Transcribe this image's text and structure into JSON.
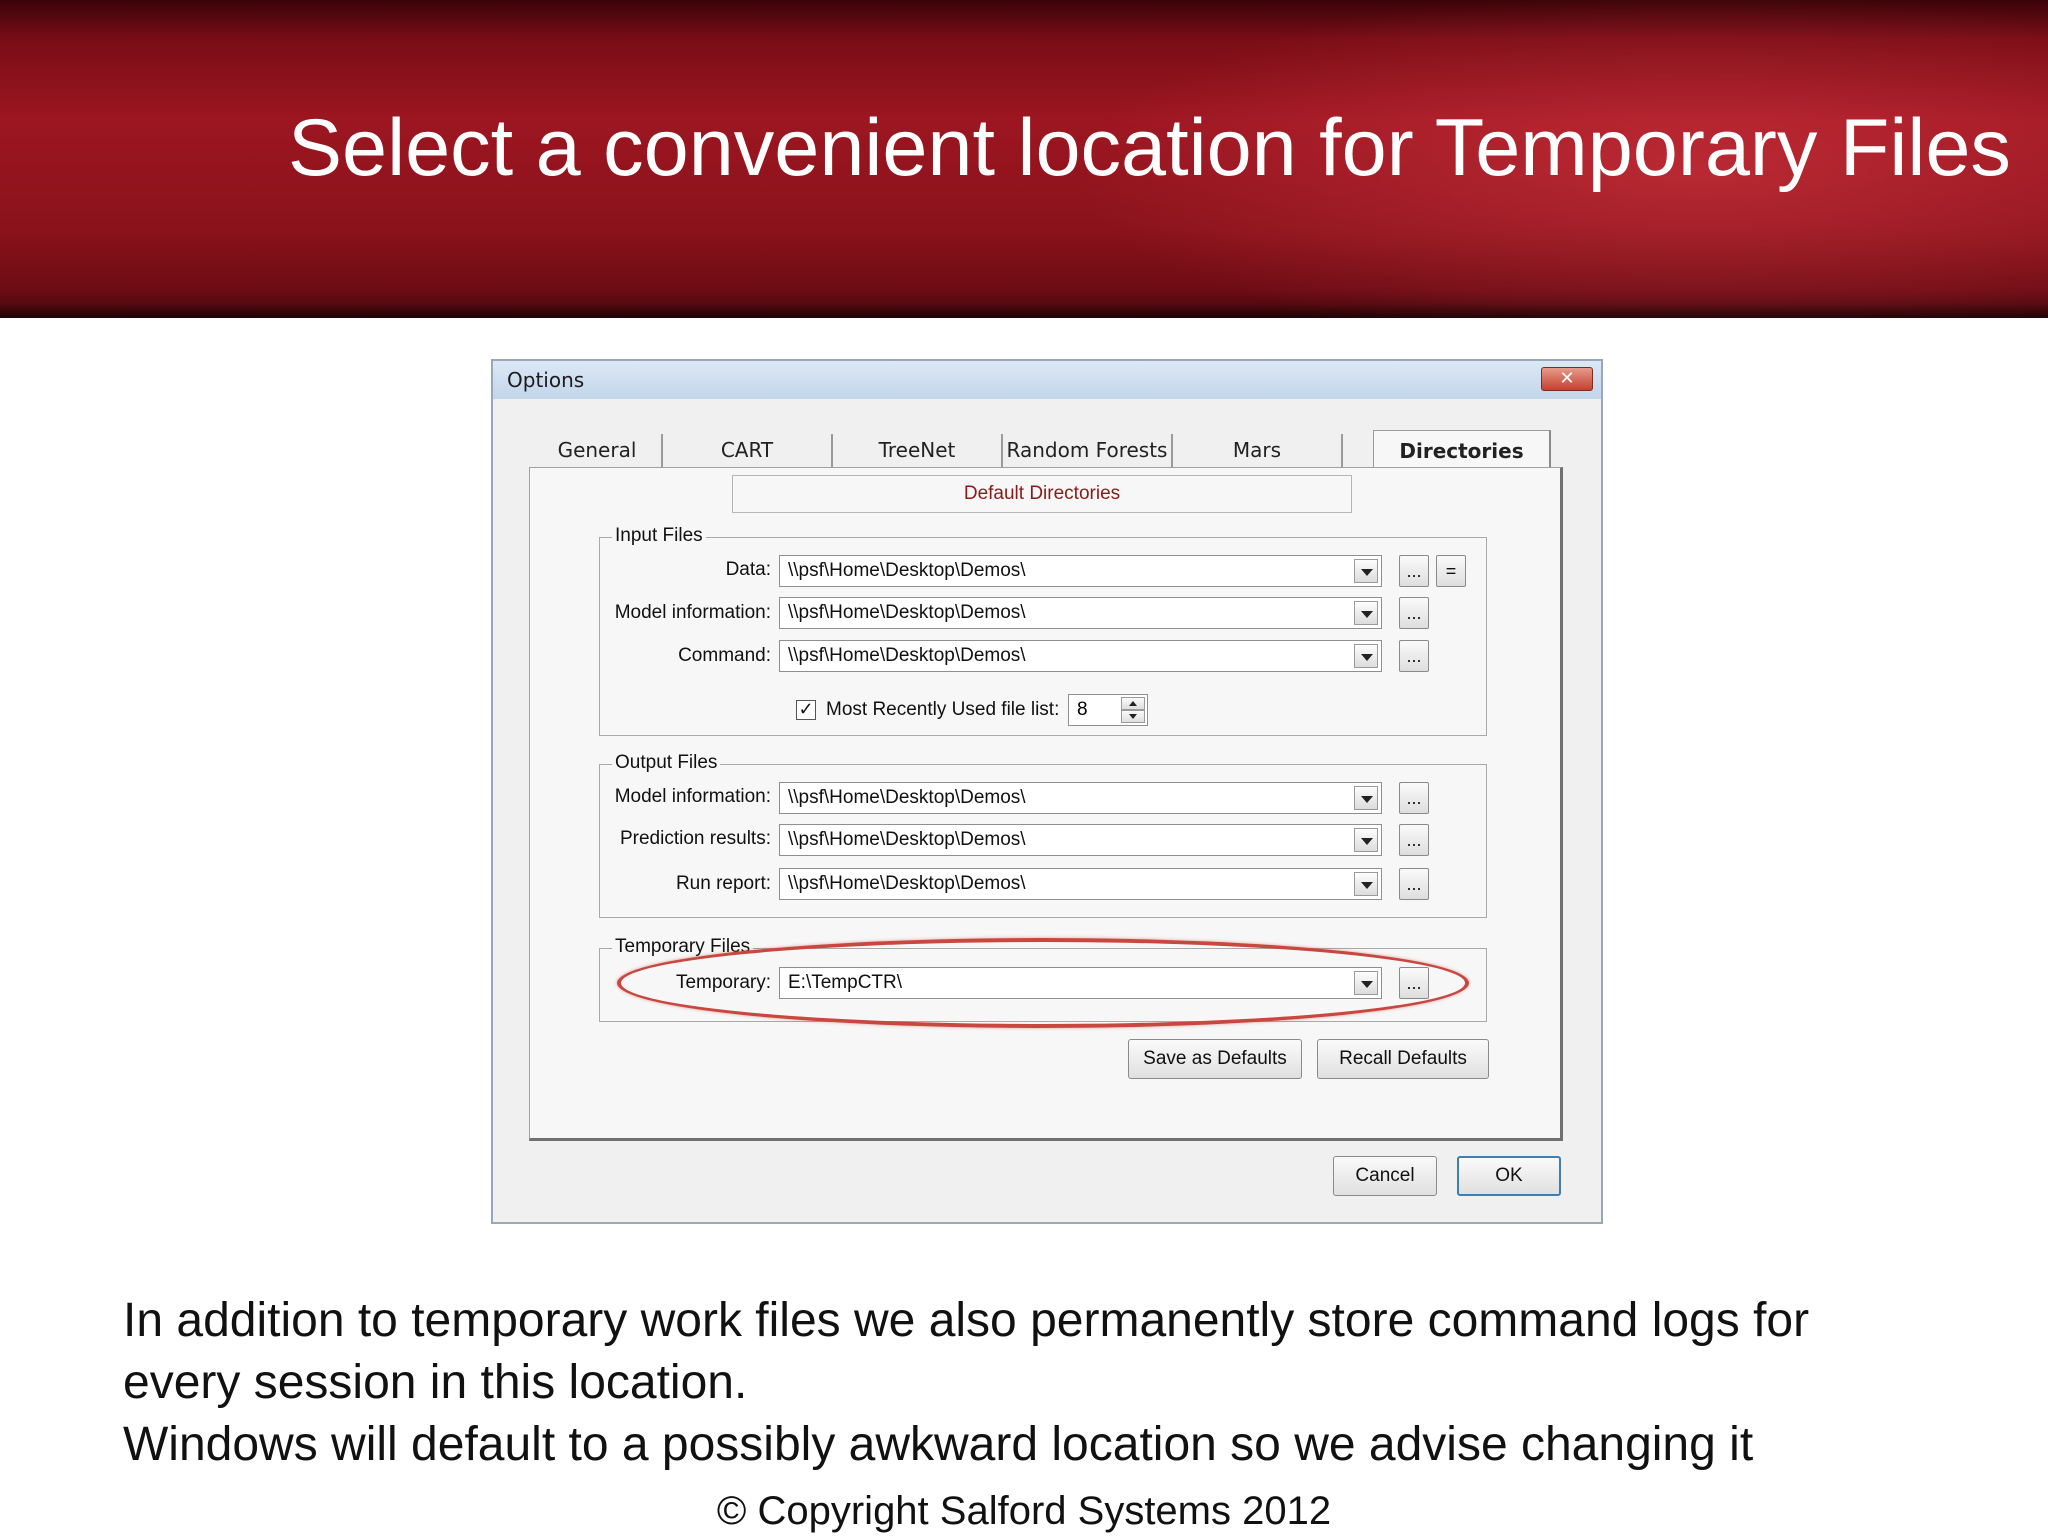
{
  "slide": {
    "title": "Select a convenient location for Temporary Files",
    "body_lines": [
      "In addition to temporary work files we also permanently store command logs for",
      "every session in this location.",
      "Windows will default to a possibly awkward location so we advise changing it"
    ],
    "copyright": "© Copyright Salford Systems 2012"
  },
  "dialog": {
    "title": "Options",
    "close_glyph": "✕",
    "tabs": [
      {
        "label": "General",
        "active": false
      },
      {
        "label": "CART",
        "active": false
      },
      {
        "label": "TreeNet",
        "active": false
      },
      {
        "label": "Random Forests",
        "active": false
      },
      {
        "label": "Mars",
        "active": false
      },
      {
        "label": "Directories",
        "active": true
      }
    ],
    "default_directories_label": "Default Directories",
    "input_files": {
      "legend": "Input Files",
      "rows": [
        {
          "label": "Data:",
          "value": "\\\\psf\\Home\\Desktop\\Demos\\"
        },
        {
          "label": "Model information:",
          "value": "\\\\psf\\Home\\Desktop\\Demos\\"
        },
        {
          "label": "Command:",
          "value": "\\\\psf\\Home\\Desktop\\Demos\\"
        }
      ],
      "browse_label": "...",
      "equals_label": "=",
      "mru_checked": "✓",
      "mru_label": "Most Recently Used file list:",
      "mru_value": "8"
    },
    "output_files": {
      "legend": "Output Files",
      "rows": [
        {
          "label": "Model information:",
          "value": "\\\\psf\\Home\\Desktop\\Demos\\"
        },
        {
          "label": "Prediction results:",
          "value": "\\\\psf\\Home\\Desktop\\Demos\\"
        },
        {
          "label": "Run report:",
          "value": "\\\\psf\\Home\\Desktop\\Demos\\"
        }
      ]
    },
    "temporary_files": {
      "legend": "Temporary Files",
      "label": "Temporary:",
      "value": "E:\\TempCTR\\"
    },
    "buttons": {
      "save_defaults": "Save as Defaults",
      "recall_defaults": "Recall Defaults",
      "cancel": "Cancel",
      "ok": "OK"
    },
    "highlight_color": "#c8473f"
  }
}
